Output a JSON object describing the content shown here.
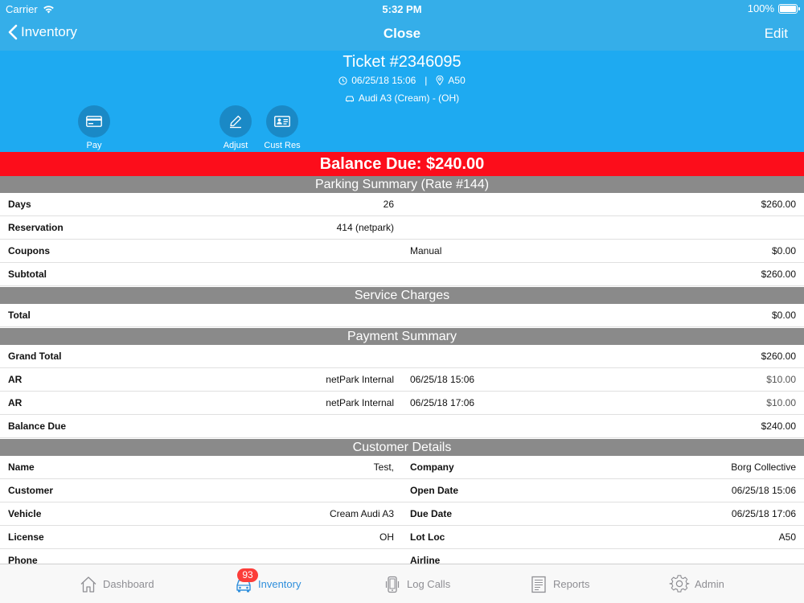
{
  "status": {
    "carrier": "Carrier",
    "time": "5:32 PM",
    "battery": "100%"
  },
  "nav": {
    "back_label": "Inventory",
    "title": "Close",
    "edit_label": "Edit"
  },
  "ticket": {
    "title": "Ticket #2346095",
    "datetime": "06/25/18 15:06",
    "separator": "|",
    "location": "A50",
    "vehicle": "Audi A3 (Cream) -  (OH)"
  },
  "actions": {
    "pay": "Pay",
    "adjust": "Adjust",
    "cust_res": "Cust Res"
  },
  "balance_banner": "Balance Due: $240.00",
  "sections": {
    "parking": "Parking Summary (Rate #144)",
    "service": "Service Charges",
    "payment": "Payment Summary",
    "customer": "Customer Details"
  },
  "parking_rows": [
    {
      "label": "Days",
      "mid": "26",
      "mid2": "",
      "value": "$260.00"
    },
    {
      "label": "Reservation",
      "mid": "414 (netpark)",
      "mid2": "",
      "value": ""
    },
    {
      "label": "Coupons",
      "mid": "",
      "mid2": "Manual",
      "value": "$0.00"
    },
    {
      "label": "Subtotal",
      "mid": "",
      "mid2": "",
      "value": "$260.00"
    }
  ],
  "service_rows": [
    {
      "label": "Total",
      "value": "$0.00"
    }
  ],
  "payment_rows": [
    {
      "label": "Grand Total",
      "mid": "",
      "mid2": "",
      "value": "$260.00"
    },
    {
      "label": "AR",
      "mid": "netPark Internal",
      "mid2": "06/25/18 15:06",
      "value": "$10.00"
    },
    {
      "label": "AR",
      "mid": "netPark Internal",
      "mid2": "06/25/18 17:06",
      "value": "$10.00"
    },
    {
      "label": "Balance Due",
      "mid": "",
      "mid2": "",
      "value": "$240.00"
    }
  ],
  "customer_rows": [
    {
      "label": "Name",
      "mid": "Test,",
      "label2": "Company",
      "value": "Borg Collective"
    },
    {
      "label": "Customer",
      "mid": "",
      "label2": "Open Date",
      "value": "06/25/18 15:06"
    },
    {
      "label": "Vehicle",
      "mid": "Cream Audi A3",
      "label2": "Due Date",
      "value": "06/25/18 17:06"
    },
    {
      "label": "License",
      "mid": "OH",
      "label2": "Lot Loc",
      "value": "A50"
    },
    {
      "label": "Phone",
      "mid": "",
      "label2": "Airline",
      "value": ""
    }
  ],
  "tabs": {
    "dashboard": "Dashboard",
    "inventory": "Inventory",
    "inventory_badge": "93",
    "log_calls": "Log Calls",
    "reports": "Reports",
    "admin": "Admin"
  },
  "colors": {
    "nav_blue": "#35aee9",
    "header_blue": "#1eaaf1",
    "balance_red": "#fc0d1b",
    "section_gray": "#8a8a8a",
    "tab_active": "#2f8fdc"
  }
}
